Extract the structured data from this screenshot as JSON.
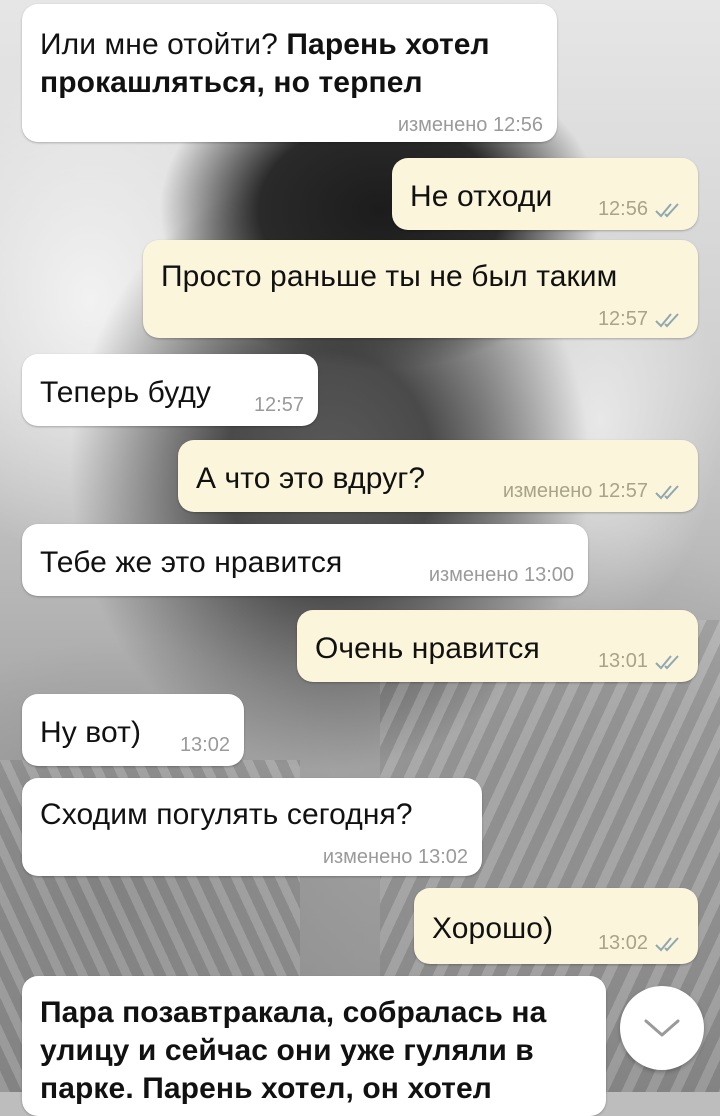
{
  "chat": {
    "messages": [
      {
        "dir": "in",
        "text_plain": "Или мне отойти? ",
        "text_bold": "Парень хотел прокашляться, но терпел",
        "meta": "изменено 12:56"
      },
      {
        "dir": "out",
        "text": "Не отходи",
        "time": "12:56"
      },
      {
        "dir": "out",
        "text": "Просто раньше ты не был таким",
        "time": "12:57"
      },
      {
        "dir": "in",
        "text": "Теперь буду",
        "time": "12:57"
      },
      {
        "dir": "out",
        "text": "А что это вдруг?",
        "meta": "изменено 12:57"
      },
      {
        "dir": "in",
        "text": "Тебе же это нравится",
        "meta": "изменено 13:00"
      },
      {
        "dir": "out",
        "text": "Очень нравится",
        "time": "13:01"
      },
      {
        "dir": "in",
        "text": "Ну вот)",
        "time": "13:02"
      },
      {
        "dir": "in",
        "text": "Сходим погулять сегодня?",
        "meta": "изменено 13:02"
      },
      {
        "dir": "out",
        "text": "Хорошо)",
        "time": "13:02"
      },
      {
        "dir": "in",
        "text_bold": "Пара позавтракала, собралась на улицу и сейчас они уже гуляли в парке. Парень хотел, он хотел"
      }
    ]
  },
  "scroll_button": {
    "icon": "chevron-down-icon"
  },
  "colors": {
    "incoming_bubble": "#ffffff",
    "outgoing_bubble": "#fbf5dc",
    "check_color": "#8fa8b0"
  }
}
